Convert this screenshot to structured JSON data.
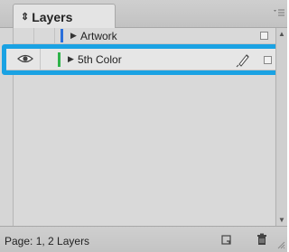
{
  "panel": {
    "tab_title": "Layers",
    "tab_chevron": "⇕",
    "menu_icon": "menu-icon"
  },
  "layers": [
    {
      "name": "Artwork",
      "color": "#2a6fdb",
      "visible": false,
      "selected": false
    },
    {
      "name": "5th Color",
      "color": "#2fb34a",
      "visible": true,
      "selected": true
    }
  ],
  "status": {
    "text": "Page: 1, 2 Layers"
  },
  "colors": {
    "selection_outline": "#1aa2e3",
    "panel_bg": "#d6d6d6"
  }
}
